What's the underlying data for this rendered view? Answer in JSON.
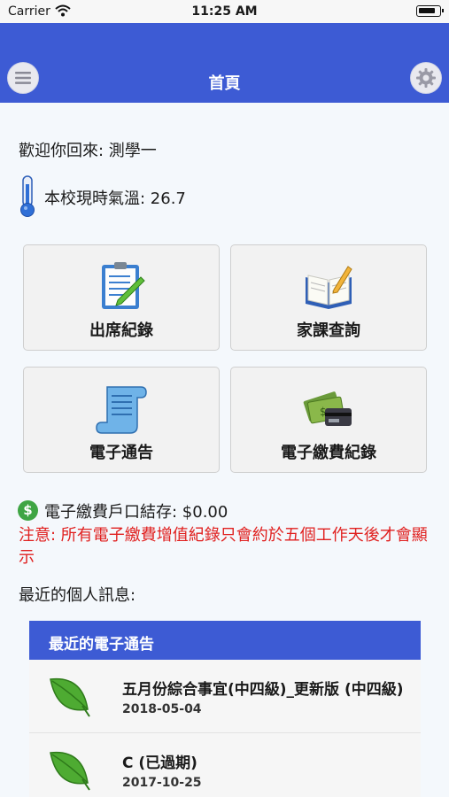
{
  "status_bar": {
    "carrier": "Carrier",
    "time": "11:25 AM"
  },
  "nav": {
    "title": "首頁",
    "menu_icon": "menu-icon",
    "settings_icon": "gear-icon"
  },
  "welcome": {
    "text": "歡迎你回來: 測學一"
  },
  "temperature": {
    "text": "本校現時氣溫: 26.7",
    "icon": "thermometer-icon"
  },
  "tiles": [
    {
      "label": "出席紀錄",
      "icon": "attendance-clipboard-icon"
    },
    {
      "label": "家課查詢",
      "icon": "homework-book-icon"
    },
    {
      "label": "電子通告",
      "icon": "notice-scroll-icon"
    },
    {
      "label": "電子繳費紀錄",
      "icon": "payment-cash-card-icon"
    }
  ],
  "balance": {
    "text": "電子繳費戶口結存: $0.00",
    "icon": "dollar-coin-icon",
    "icon_symbol": "$"
  },
  "notice": {
    "text": "注意: 所有電子繳費增值紀錄只會約於五個工作天後才會顯示"
  },
  "recent_messages": {
    "label": "最近的個人訊息:"
  },
  "recent_notices": {
    "title": "最近的電子通告",
    "items": [
      {
        "title": "五月份綜合事宜(中四級)_更新版 (中四級)",
        "date": "2018-05-04",
        "icon": "leaf-icon"
      },
      {
        "title": "C (已過期)",
        "date": "2017-10-25",
        "icon": "leaf-icon"
      }
    ]
  },
  "colors": {
    "primary": "#3d5bd4",
    "warning": "#e0201f",
    "coin": "#3fa544",
    "leaf": "#3f9a2f"
  }
}
